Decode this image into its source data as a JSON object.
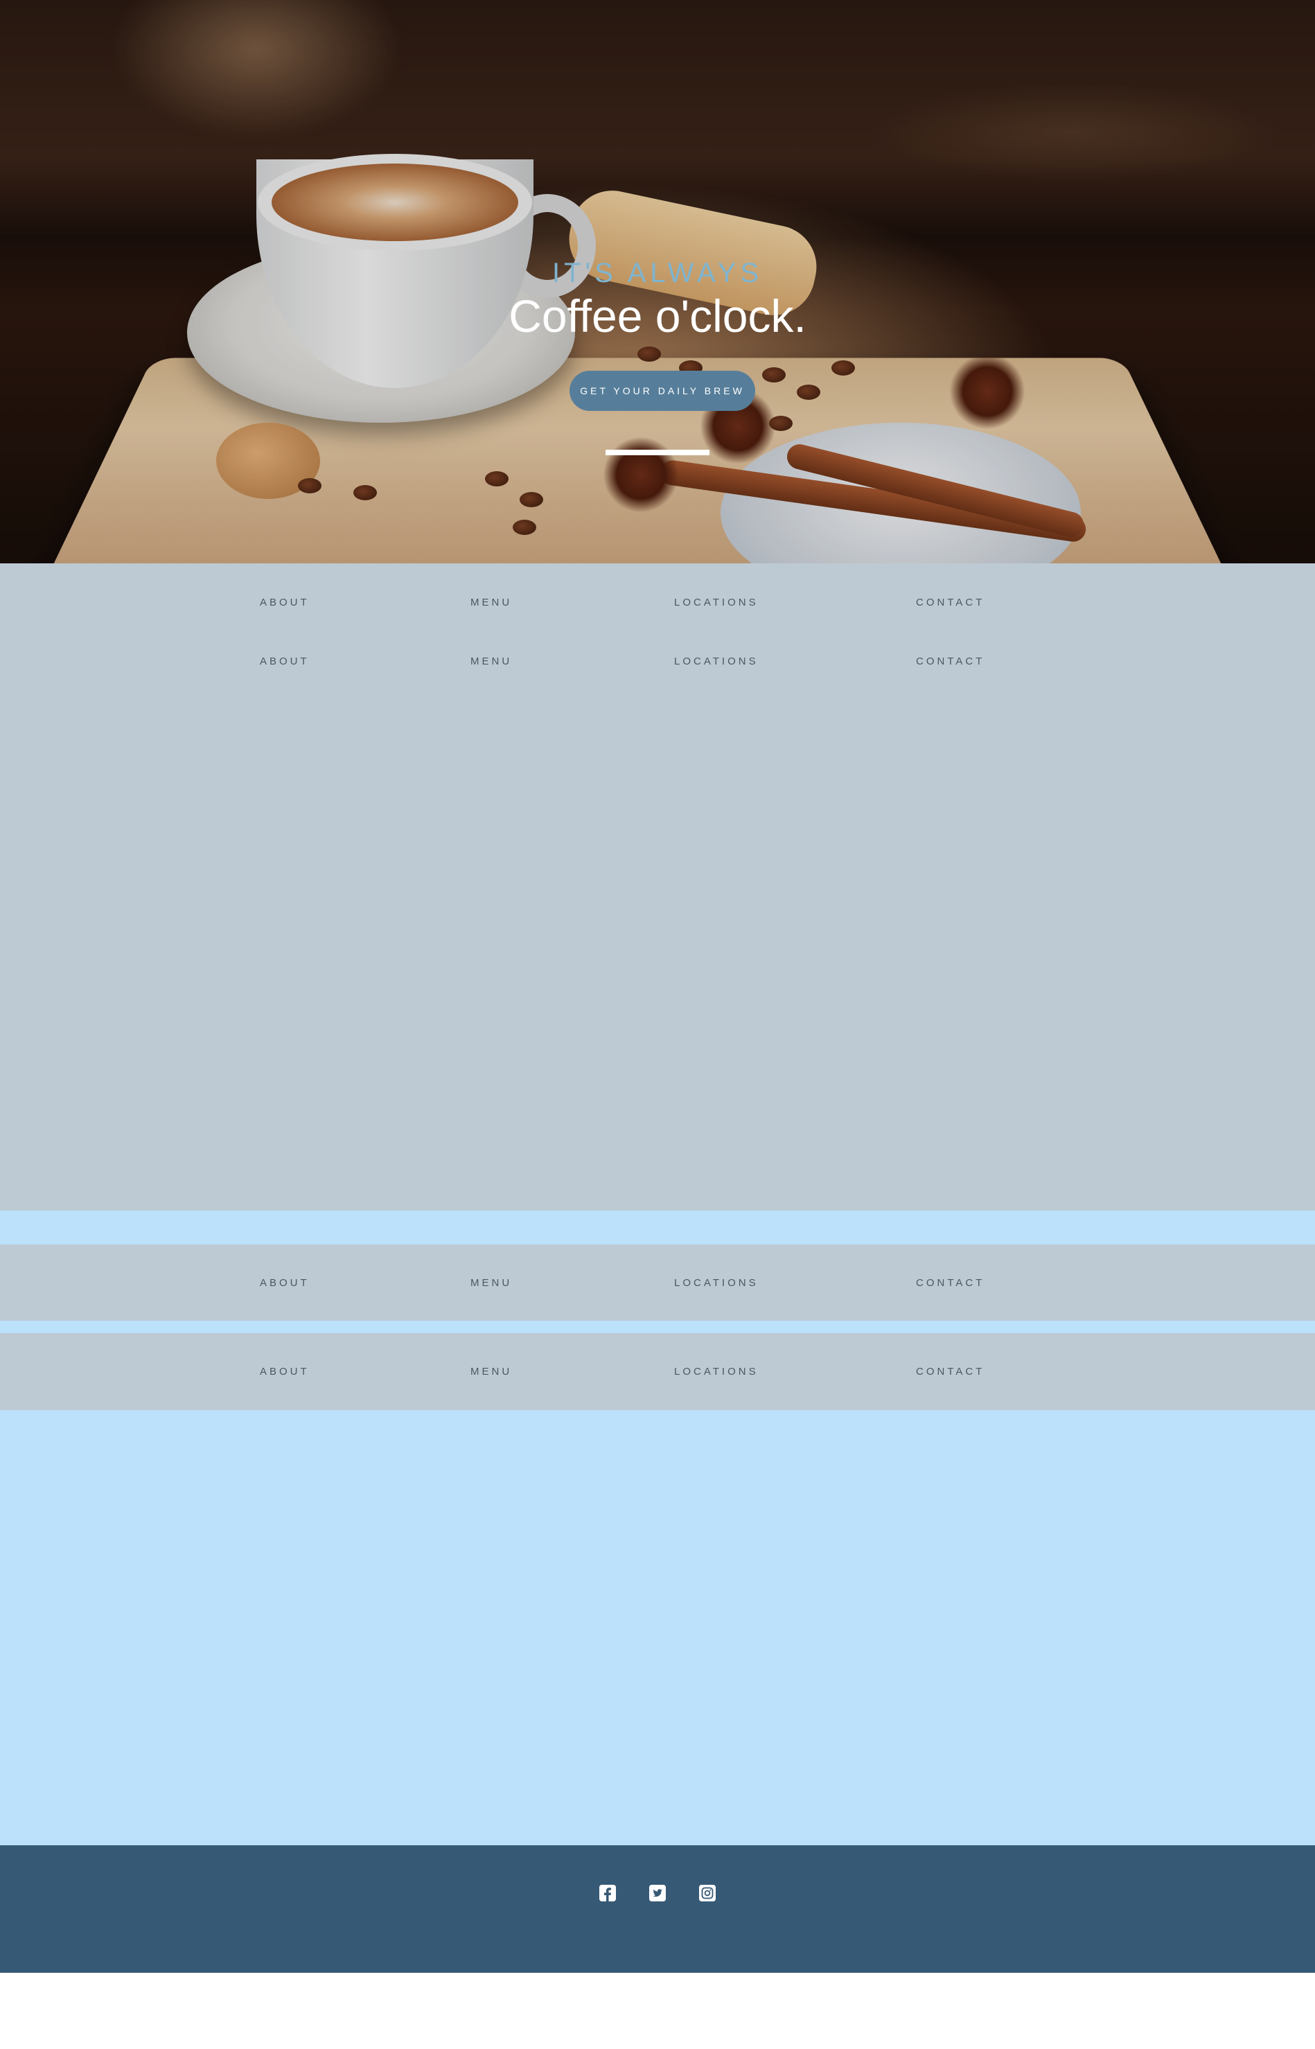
{
  "hero": {
    "kicker": "IT'S ALWAYS",
    "title": "Coffee o'clock.",
    "cta_label": "GET YOUR DAILY BREW"
  },
  "nav_rows": [
    {
      "about": "ABOUT",
      "menu": "MENU",
      "locations": "LOCATIONS",
      "contact": "CONTACT"
    },
    {
      "about": "ABOUT",
      "menu": "MENU",
      "locations": "LOCATIONS",
      "contact": "CONTACT"
    },
    {
      "about": "ABOUT",
      "menu": "MENU",
      "locations": "LOCATIONS",
      "contact": "CONTACT"
    },
    {
      "about": "ABOUT",
      "menu": "MENU",
      "locations": "LOCATIONS",
      "contact": "CONTACT"
    }
  ],
  "footer": {
    "social_icons": [
      "facebook-icon",
      "twitter-icon",
      "instagram-icon"
    ]
  },
  "colors": {
    "kicker": "#7fb4cf",
    "button": "#567e9a",
    "nav_band": "#bdcad3",
    "light_blue": "#bbe1fb",
    "footer": "#365975",
    "nav_text": "#4a5763"
  }
}
